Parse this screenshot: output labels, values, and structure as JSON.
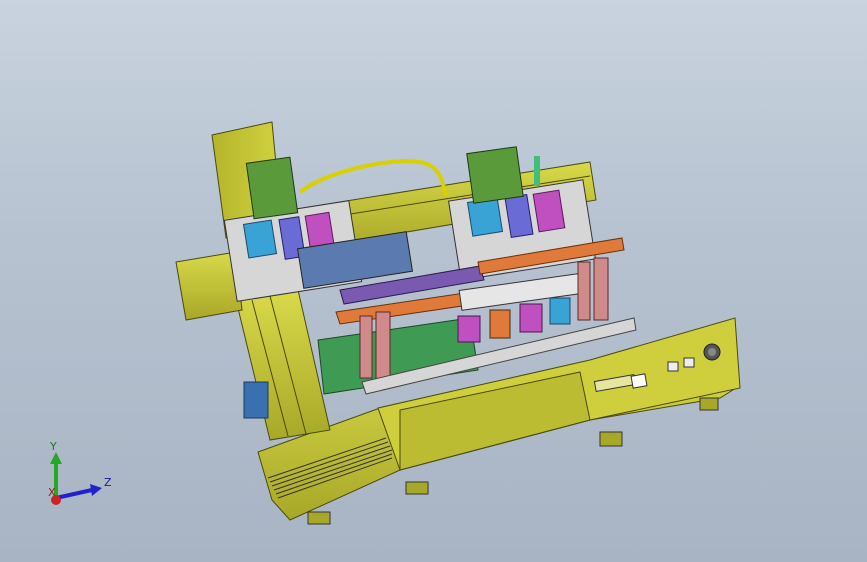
{
  "view": {
    "type": "cad-3d-viewport",
    "background_top": "#c9d3df",
    "background_bottom": "#a8b4c3"
  },
  "model": {
    "primary_color": "#c8c83a",
    "shade_color": "#9a9a22",
    "accent_colors": [
      "#3aa3d6",
      "#c04fc0",
      "#e07a3a",
      "#4aa04a",
      "#d6d6d6",
      "#6b6bd6"
    ]
  },
  "triad": {
    "x_label": "X",
    "y_label": "Y",
    "z_label": "Z",
    "x_color": "#cc2222",
    "y_color": "#22aa22",
    "z_color": "#2222cc"
  }
}
